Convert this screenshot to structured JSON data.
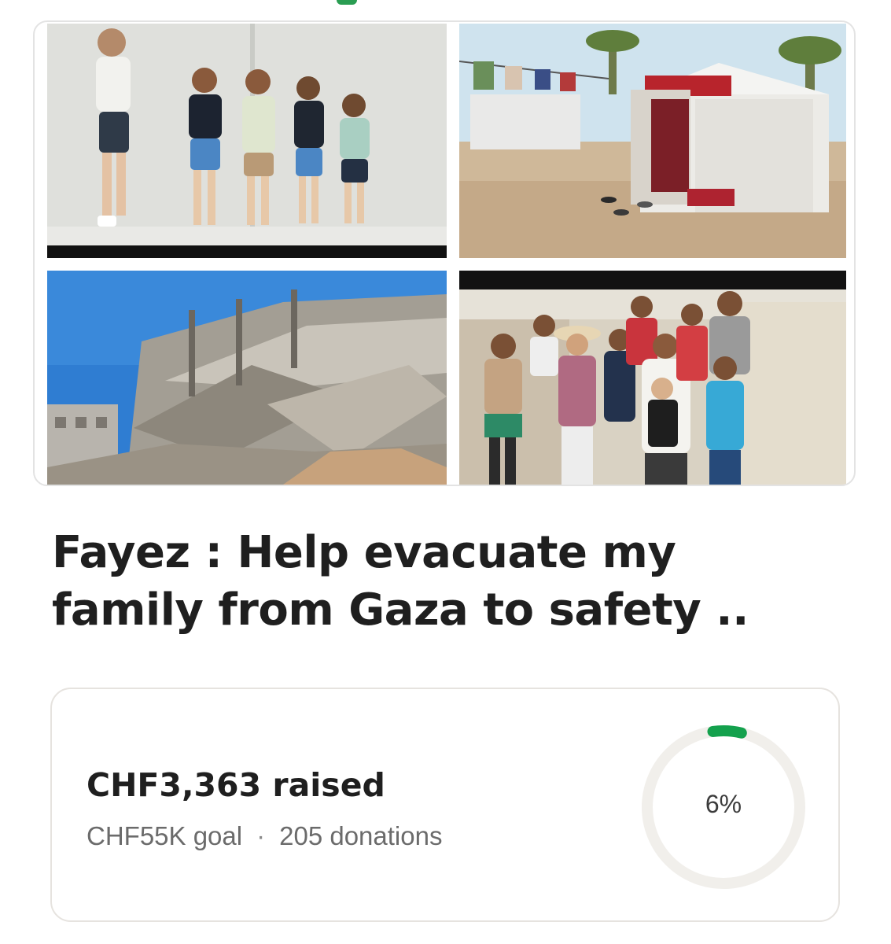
{
  "campaign": {
    "title_line1": "Fayez : Help evacuate my",
    "title_line2": "family from Gaza to safety .."
  },
  "photos": [
    {
      "alt": "Five young children standing against a wall"
    },
    {
      "alt": "Tent in a displacement camp"
    },
    {
      "alt": "Destroyed buildings and rubble"
    },
    {
      "alt": "Group of children and a man standing in front of tents"
    }
  ],
  "fundraiser": {
    "raised_text": "CHF3,363 raised",
    "goal_text": "CHF55K goal",
    "separator": "·",
    "donations_text": "205 donations",
    "percent_text": "6%",
    "progress_fraction": 0.06
  },
  "colors": {
    "accent_green": "#14a14d",
    "ring_track": "#f1efeb",
    "title_text": "#1f1f1f",
    "muted_text": "#6b6b6b"
  }
}
